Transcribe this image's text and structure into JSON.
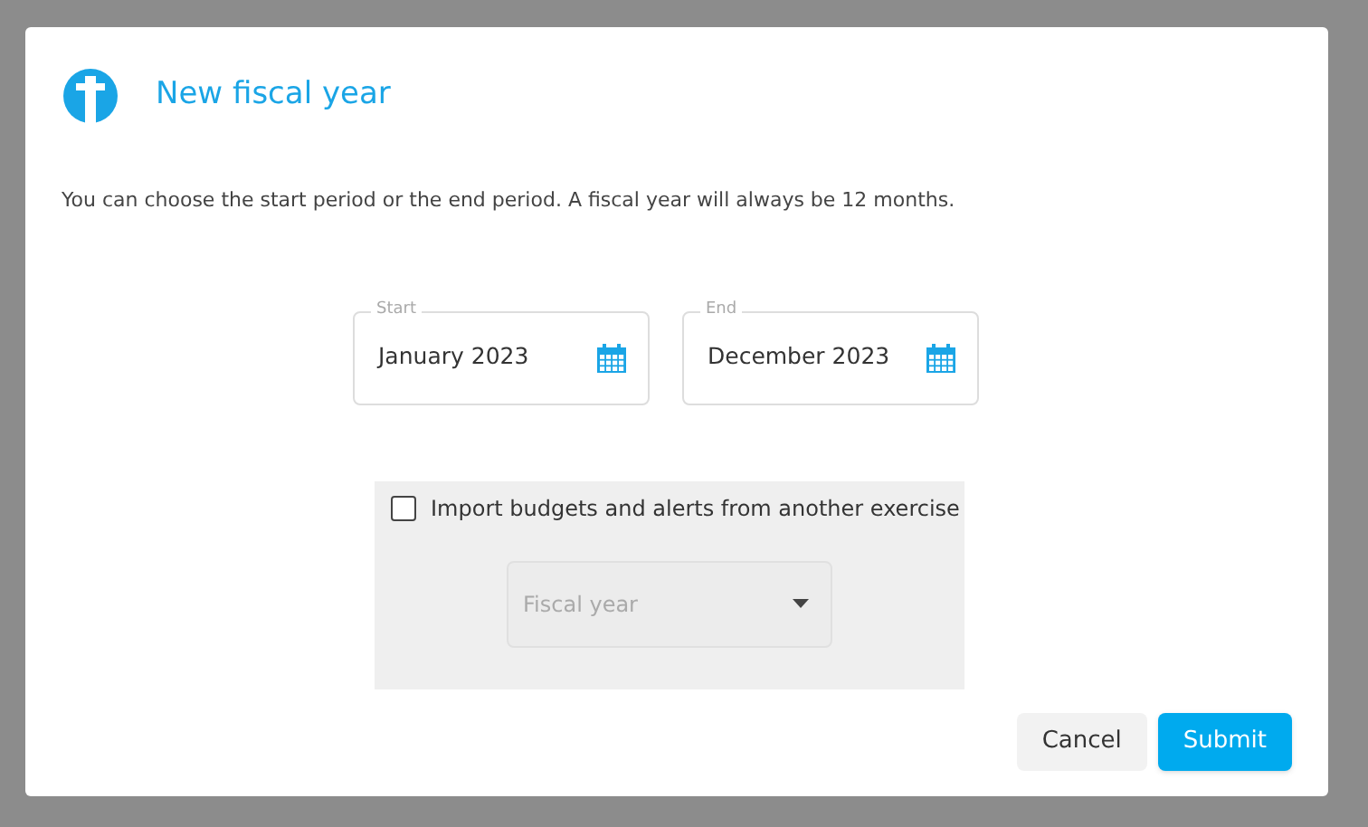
{
  "dialog": {
    "title": "New fiscal year",
    "description": "You can choose the start period or the end period. A fiscal year will always be 12 months.",
    "periods": [
      {
        "label": "Start",
        "value": "January 2023"
      },
      {
        "label": "End",
        "value": "December 2023"
      }
    ],
    "import": {
      "label": "Import budgets and alerts from another exercise",
      "checked": false,
      "dropdown": {
        "placeholder": "Fiscal year",
        "disabled": true
      }
    },
    "buttons": [
      {
        "label": "Cancel",
        "kind": "secondary"
      },
      {
        "label": "Submit",
        "kind": "primary"
      }
    ]
  }
}
